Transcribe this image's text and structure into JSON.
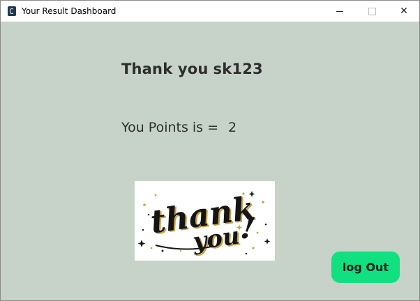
{
  "window": {
    "title": "Your Result Dashboard",
    "icon": "app-icon",
    "controls": [
      "minimize",
      "maximize",
      "close"
    ]
  },
  "main": {
    "thank_label": "Thank you",
    "username": "sk123",
    "points_label": "You Points is =",
    "points_value": "2",
    "image_text": "thank you!",
    "logout_label": "log Out"
  },
  "colors": {
    "background": "#c7d3c8",
    "text": "#2d2d2d",
    "logout_button": "#10e080",
    "image_accent": "#c8a24a"
  }
}
